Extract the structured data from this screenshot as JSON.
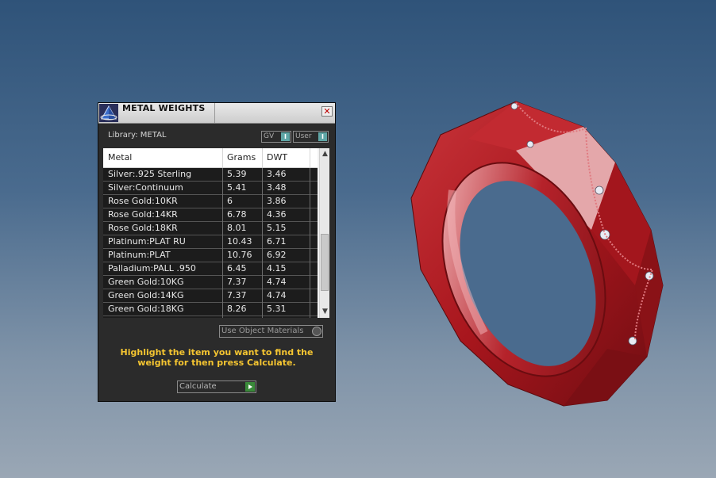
{
  "panel": {
    "title": "METAL WEIGHTS",
    "close_glyph": "✕",
    "library_label": "Library: METAL",
    "toggles": [
      {
        "label": "GV",
        "state_glyph": "I"
      },
      {
        "label": "User",
        "state_glyph": "I"
      }
    ],
    "table": {
      "headers": [
        "Metal",
        "Grams",
        "DWT"
      ],
      "rows": [
        [
          "Silver:.925 Sterling",
          "5.39",
          "3.46"
        ],
        [
          "Silver:Continuum",
          "5.41",
          "3.48"
        ],
        [
          "Rose Gold:10KR",
          "6",
          "3.86"
        ],
        [
          "Rose Gold:14KR",
          "6.78",
          "4.36"
        ],
        [
          "Rose Gold:18KR",
          "8.01",
          "5.15"
        ],
        [
          "Platinum:PLAT RU",
          "10.43",
          "6.71"
        ],
        [
          "Platinum:PLAT",
          "10.76",
          "6.92"
        ],
        [
          "Palladium:PALL .950",
          "6.45",
          "4.15"
        ],
        [
          "Green Gold:10KG",
          "7.37",
          "4.74"
        ],
        [
          "Green Gold:14KG",
          "7.37",
          "4.74"
        ],
        [
          "Green Gold:18KG",
          "8.26",
          "5.31"
        ]
      ]
    },
    "use_object_materials_label": "Use Object Materials",
    "instructions": "Highlight the item you want to find the weight for then press Calculate.",
    "calculate_label": "Calculate"
  },
  "colors": {
    "instruction_text": "#f5c531",
    "ring": "#b01e24",
    "panel_bg": "#2b2b2b"
  },
  "icons": {
    "title_logo": "pyramid-logo-icon",
    "close": "close-icon",
    "scroll_up": "scroll-up-arrow-icon",
    "scroll_down": "scroll-down-arrow-icon",
    "calculate_go": "play-arrow-icon"
  }
}
